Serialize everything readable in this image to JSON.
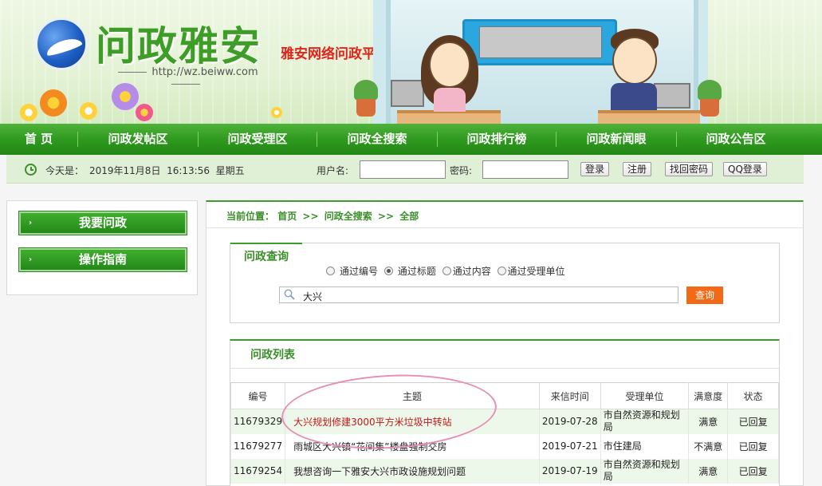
{
  "banner": {
    "logo_title": "问政雅安",
    "logo_subtitle": "雅安网络问政平台",
    "logo_url": "http://wz.beiww.com"
  },
  "nav": {
    "items": [
      "首 页",
      "问政发帖区",
      "问政受理区",
      "问政全搜索",
      "问政排行榜",
      "问政新闻眼",
      "问政公告区"
    ]
  },
  "infobar": {
    "today_label": "今天是：",
    "today_value": "2019年11月8日  16:13:56  星期五",
    "username_label": "用户名:",
    "password_label": "密码:",
    "login_label": "登录",
    "register_label": "注册",
    "recover_label": "找回密码",
    "qq_label": "QQ登录"
  },
  "sidebar": {
    "ask_label": "我要问政",
    "guide_label": "操作指南"
  },
  "breadcrumb": {
    "prefix": "当前位置：",
    "items": [
      "首页",
      "问政全搜索",
      "全部"
    ],
    "separator": ">>"
  },
  "query": {
    "title": "问政查询",
    "options": [
      "通过编号",
      "通过标题",
      "通过内容",
      "通过受理单位"
    ],
    "selected_index": 1,
    "search_value": "大兴",
    "button_label": "查询"
  },
  "list": {
    "title": "问政列表",
    "columns": [
      "编号",
      "主题",
      "来信时间",
      "受理单位",
      "满意度",
      "状态"
    ],
    "rows": [
      {
        "id": "11679329",
        "topic": "大兴规划修建3000平方米垃圾中转站",
        "date": "2019-07-28",
        "unit": "市自然资源和规划局",
        "satisfaction": "满意",
        "status": "已回复"
      },
      {
        "id": "11679277",
        "topic": "雨城区大兴镇“花间集”楼盘强制交房",
        "date": "2019-07-21",
        "unit": "市住建局",
        "satisfaction": "不满意",
        "status": "已回复"
      },
      {
        "id": "11679254",
        "topic": "我想咨询一下雅安大兴市政设施规划问题",
        "date": "2019-07-19",
        "unit": "市自然资源和规划局",
        "satisfaction": "满意",
        "status": "已回复"
      }
    ]
  },
  "colors": {
    "brand_green": "#3d9c2b",
    "nav_green": "#2f9a1f",
    "accent_orange": "#f26a16",
    "highlight_red": "#c31818"
  }
}
